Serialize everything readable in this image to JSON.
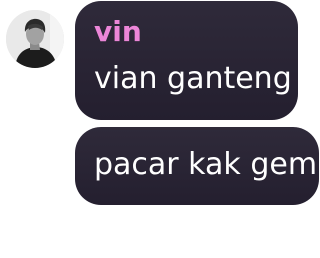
{
  "chat": {
    "sender": {
      "username": "vin",
      "username_color": "#ec86d8",
      "avatar_icon": "profile-photo"
    },
    "messages": [
      {
        "text": "vian ganteng"
      },
      {
        "text": "pacar kak gem"
      }
    ],
    "colors": {
      "bubble": "#2a2535",
      "text": "#ffffff",
      "background": "#ffffff"
    }
  }
}
